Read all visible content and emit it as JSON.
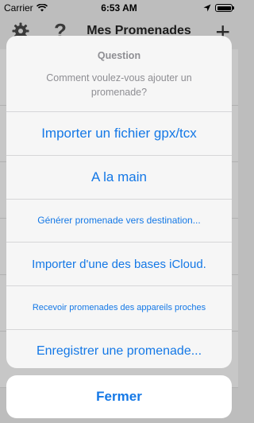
{
  "status_bar": {
    "carrier": "Carrier",
    "time": "6:53 AM"
  },
  "navbar": {
    "title": "Mes Promenades",
    "help_glyph": "?",
    "add_glyph": "+"
  },
  "sheet": {
    "title": "Question",
    "message": "Comment voulez-vous ajouter un promenade?",
    "actions": [
      {
        "label": "Importer un fichier gpx/tcx"
      },
      {
        "label": "A la main"
      },
      {
        "label": "Générer promenade vers destination..."
      },
      {
        "label": "Importer d'une des bases iCloud."
      },
      {
        "label": "Recevoir promenades des appareils proches"
      },
      {
        "label": "Enregistrer une promenade..."
      }
    ],
    "cancel_label": "Fermer"
  },
  "colors": {
    "accent": "#1478e6",
    "dim_background": "#bdbdbd"
  }
}
